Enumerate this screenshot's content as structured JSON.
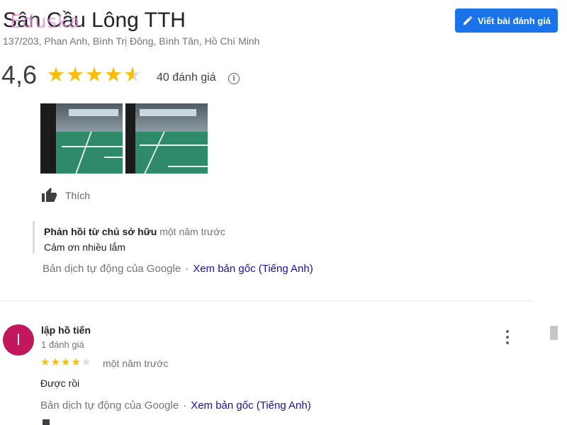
{
  "place": {
    "name": "Sân Cầu Lông TTH",
    "watermark": "Eduska",
    "address": "137/203, Phan Anh, Bình Trị Đông, Bình Tân, Hồ Chí Minh"
  },
  "actions": {
    "write_review": "Viết bài đánh giá"
  },
  "rating": {
    "value": "4,6",
    "stars": 4.5,
    "count_text": "40 đánh giá",
    "info_symbol": "i"
  },
  "review1": {
    "photos": [
      "badminton-court-photo-1",
      "badminton-court-photo-2"
    ],
    "like_label": "Thích",
    "owner_reply": {
      "title": "Phản hồi từ chủ sở hữu",
      "time": "một năm trước",
      "text": "Cảm ơn nhiều lắm"
    },
    "translation": {
      "note": "Bản dịch tự động của Google",
      "separator": "·",
      "link": "Xem bản gốc (Tiếng Anh)"
    }
  },
  "review2": {
    "avatar_initial": "l",
    "reviewer_name": "lập hồ tiến",
    "reviewer_count": "1 đánh giá",
    "stars": 4,
    "time": "một năm trước",
    "text": "Được rồi",
    "translation": {
      "note": "Bản dịch tự động của Google",
      "separator": "·",
      "link": "Xem bản gốc (Tiếng Anh)"
    }
  },
  "colors": {
    "accent": "#1a73e8",
    "star": "#fbbc04",
    "avatar": "#c2185b",
    "link": "#1a0dab"
  }
}
